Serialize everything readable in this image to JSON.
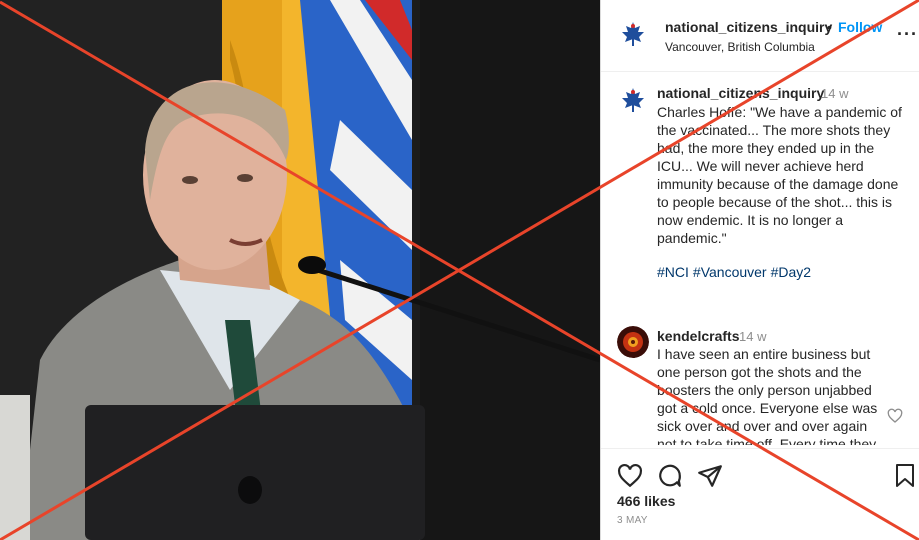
{
  "post": {
    "username": "national_citizens_inquiry",
    "follow_label": "Follow",
    "location": "Vancouver, British Columbia",
    "caption_time": "14 w",
    "caption": "Charles Hoffe: \"We have a pandemic of the vaccinated... The more shots they had, the more they ended up in the ICU... We will never achieve herd immunity because of the damage done to people because of the shot... this is now endemic. It is no longer a pandemic.\"",
    "hashtags": [
      "#NCI",
      "#Vancouver",
      "#Day2"
    ],
    "likes": "466 likes",
    "date": "3 MAY"
  },
  "comment": {
    "username": "kendelcrafts",
    "time": "14 w",
    "text": "I have seen an entire business but one person got the shots and the boosters the only person unjabbed got a cold once. Everyone else was sick over and over and over again not to take time off. Every time they"
  },
  "colors": {
    "link": "#0095f6",
    "hashtag": "#00376b",
    "cross": "#e8442a",
    "logo": "#1f4e9c"
  },
  "icons": [
    "more-options-icon",
    "heart-icon",
    "comment-icon",
    "share-icon",
    "bookmark-icon"
  ]
}
